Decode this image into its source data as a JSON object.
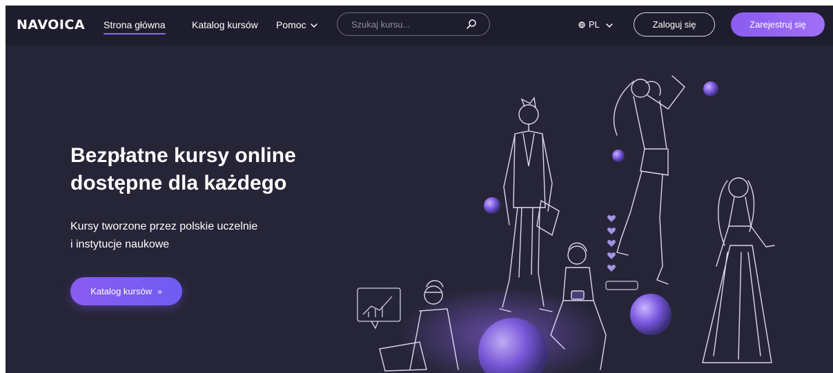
{
  "brand": {
    "logo": "NAVOICA"
  },
  "nav": {
    "home": "Strona główna",
    "catalog": "Katalog kursów",
    "help": "Pomoc"
  },
  "search": {
    "placeholder": "Szukaj kursu..."
  },
  "language": {
    "current": "PL"
  },
  "auth": {
    "login": "Zaloguj się",
    "register": "Zarejestruj się"
  },
  "hero": {
    "title_line1": "Bezpłatne kursy online",
    "title_line2": "dostępne dla każdego",
    "subtitle_line1": "Kursy tworzone przez polskie uczelnie",
    "subtitle_line2": "i instytucje naukowe",
    "cta": "Katalog kursów",
    "cta_arrows": "»"
  },
  "icons": {
    "search": "search-icon",
    "globe": "globe-icon",
    "chevron": "chevron-down-icon"
  },
  "colors": {
    "background": "#262538",
    "navbar": "#1e1d2e",
    "accent": "#8a5cf0",
    "text": "#ffffff"
  }
}
